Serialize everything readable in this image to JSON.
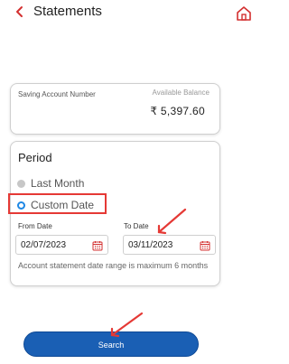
{
  "header": {
    "title": "Statements"
  },
  "account": {
    "label": "Saving Account Number",
    "balance_label": "Available Balance",
    "balance_value": "₹ 5,397.60"
  },
  "period": {
    "title": "Period",
    "options": [
      {
        "label": "Last Month",
        "selected": false
      },
      {
        "label": "Custom Date",
        "selected": true
      }
    ],
    "from_label": "From Date",
    "from_value": "02/07/2023",
    "to_label": "To Date",
    "to_value": "03/11/2023",
    "note": "Account statement date range is maximum 6 months"
  },
  "search": {
    "label": "Search"
  },
  "colors": {
    "accent": "#1a5fb4",
    "brand_red": "#d32f2f",
    "highlight": "#e53935",
    "radio_on": "#1e88e5"
  },
  "icons": {
    "back": "chevron-left-icon",
    "home": "home-icon",
    "calendar": "calendar-icon"
  }
}
